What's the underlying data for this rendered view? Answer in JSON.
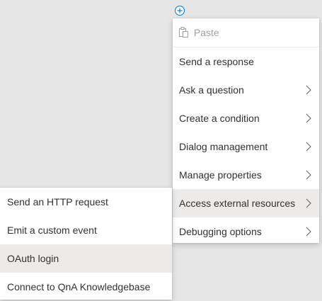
{
  "add_button": {
    "icon": "plus-circle-icon",
    "color": "#0078d4"
  },
  "main_menu": {
    "paste": {
      "label": "Paste",
      "icon": "paste-icon",
      "disabled": true
    },
    "items": [
      {
        "label": "Send a response",
        "has_submenu": false
      },
      {
        "label": "Ask a question",
        "has_submenu": true
      },
      {
        "label": "Create a condition",
        "has_submenu": true
      },
      {
        "label": "Dialog management",
        "has_submenu": true
      },
      {
        "label": "Manage properties",
        "has_submenu": true
      },
      {
        "label": "Access external resources",
        "has_submenu": true,
        "expanded": true
      },
      {
        "label": "Debugging options",
        "has_submenu": true
      }
    ]
  },
  "sub_menu": {
    "parent": "Access external resources",
    "items": [
      {
        "label": "Send an HTTP request"
      },
      {
        "label": "Emit a custom event"
      },
      {
        "label": "OAuth login",
        "hovered": true
      },
      {
        "label": "Connect to QnA Knowledgebase"
      }
    ]
  },
  "colors": {
    "background": "#e6e6e6",
    "menu_background": "#ffffff",
    "highlight": "#edebe9",
    "text": "#323130",
    "disabled_text": "#a19f9d",
    "accent": "#0078d4"
  }
}
